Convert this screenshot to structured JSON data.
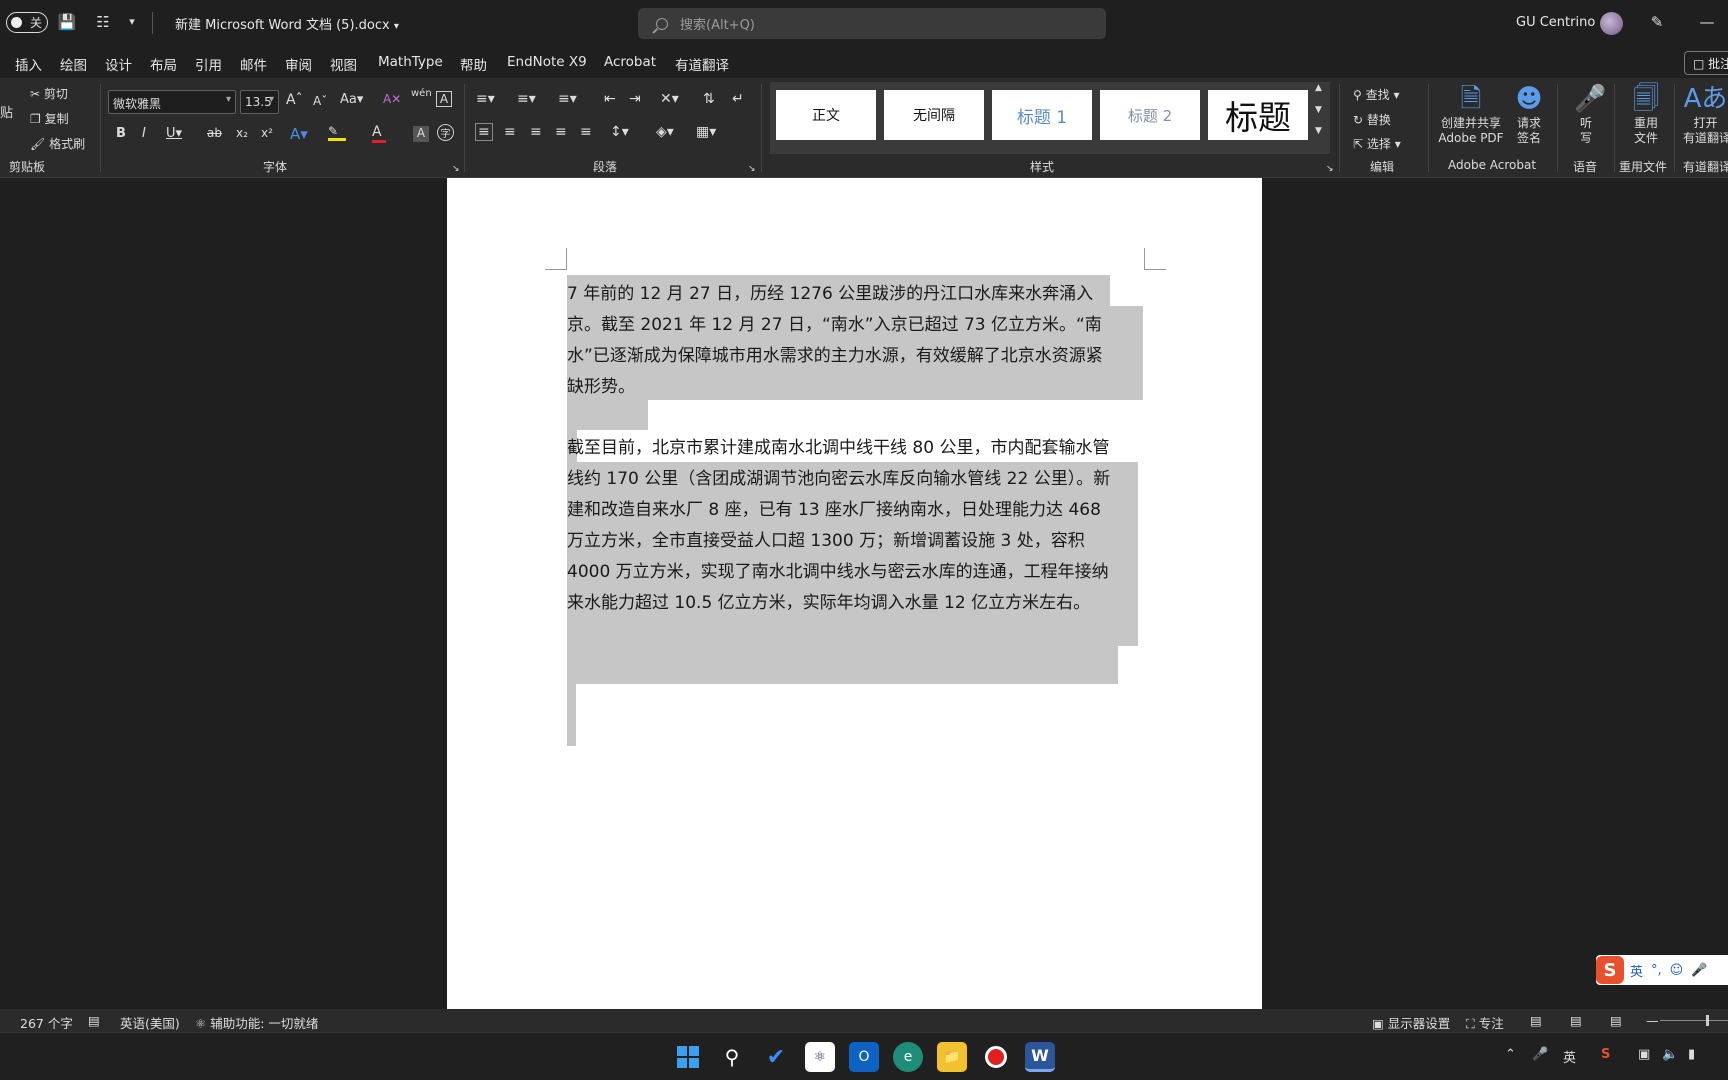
{
  "titlebar": {
    "autosave": "关",
    "doc_title": "新建 Microsoft Word 文档 (5).docx",
    "search_placeholder": "搜索(Alt+Q)",
    "user_name": "GU Centrino"
  },
  "menu": [
    "插入",
    "绘图",
    "设计",
    "布局",
    "引用",
    "邮件",
    "审阅",
    "视图",
    "MathType",
    "帮助",
    "EndNote X9",
    "Acrobat",
    "有道翻译"
  ],
  "comments_button": "批注",
  "ribbon": {
    "clipboard": {
      "paste": "贴",
      "cut": "剪切",
      "copy": "复制",
      "format_painter": "格式刷",
      "label": "剪贴板"
    },
    "font": {
      "font_name": "微软雅黑",
      "font_size": "13.5",
      "label": "字体"
    },
    "paragraph": {
      "label": "段落"
    },
    "styles": {
      "items": [
        "正文",
        "无间隔",
        "标题 1",
        "标题 2",
        "标题"
      ],
      "label": "样式"
    },
    "editing": {
      "find": "查找",
      "replace": "替换",
      "select": "选择",
      "label": "编辑"
    },
    "acrobat": {
      "create_share": "创建并共享",
      "adobe_pdf": "Adobe PDF",
      "request": "请求",
      "sign": "签名",
      "label": "Adobe Acrobat"
    },
    "voice": {
      "dictate_1": "听",
      "dictate_2": "写",
      "label": "语音"
    },
    "reuse": {
      "line1": "重用",
      "line2": "文件",
      "label": "重用文件"
    },
    "youdao": {
      "line1": "打开",
      "line2": "有道翻译",
      "label": "有道翻译"
    }
  },
  "document": {
    "lines": [
      "7 年前的 12 月 27 日，历经 1276 公里跋涉的丹江口水库来水奔涌入",
      "京。截至 2021 年 12 月 27 日，“南水”入京已超过 73 亿立方米。“南",
      "水”已逐渐成为保障城市用水需求的主力水源，有效缓解了北京水资源紧",
      "缺形势。",
      "截至目前，北京市累计建成南水北调中线干线 80 公里，市内配套输水管",
      "线约 170 公里（含团成湖调节池向密云水库反向输水管线 22 公里）。新",
      "建和改造自来水厂 8 座，已有 13 座水厂接纳南水，日处理能力达 468",
      "万立方米，全市直接受益人口超 1300 万；新增调蓄设施 3 处，容积",
      "4000 万立方米，实现了南水北调中线水与密云水库的连通，工程年接纳",
      "来水能力超过 10.5 亿立方米，实际年均调入水量 12 亿立方米左右。"
    ]
  },
  "statusbar": {
    "word_count": "267 个字",
    "language": "英语(美国)",
    "accessibility": "辅助功能: 一切就绪",
    "display_settings": "显示器设置",
    "focus": "专注"
  },
  "ime": {
    "mode": "英"
  },
  "taskbar": {
    "tray_lang": "英"
  }
}
